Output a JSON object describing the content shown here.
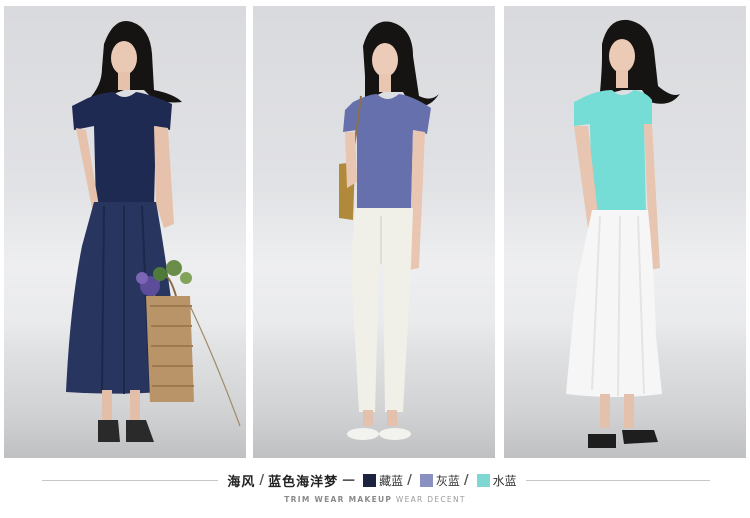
{
  "photos": [
    {
      "name": "model-navy",
      "top_color": "#1f2a52",
      "bottom_color": "#27355f"
    },
    {
      "name": "model-grey-blue",
      "top_color": "#6570ad",
      "bottom_color": "#f1f0e8"
    },
    {
      "name": "model-aqua",
      "top_color": "#76dcd6",
      "bottom_color": "#f6f6f6"
    }
  ],
  "caption": {
    "title_a": "海风",
    "separator": "/",
    "title_b": "蓝色海洋梦",
    "dash": "—",
    "colors": [
      {
        "label": "藏蓝",
        "hex": "#1c2340",
        "slash": "/"
      },
      {
        "label": "灰蓝",
        "hex": "#8a90c2",
        "slash": "/"
      },
      {
        "label": "水蓝",
        "hex": "#7fd6d2",
        "slash": ""
      }
    ]
  },
  "subtitle": {
    "bold": "TRIM WEAR MAKEUP",
    "light": "WEAR DECENT"
  }
}
